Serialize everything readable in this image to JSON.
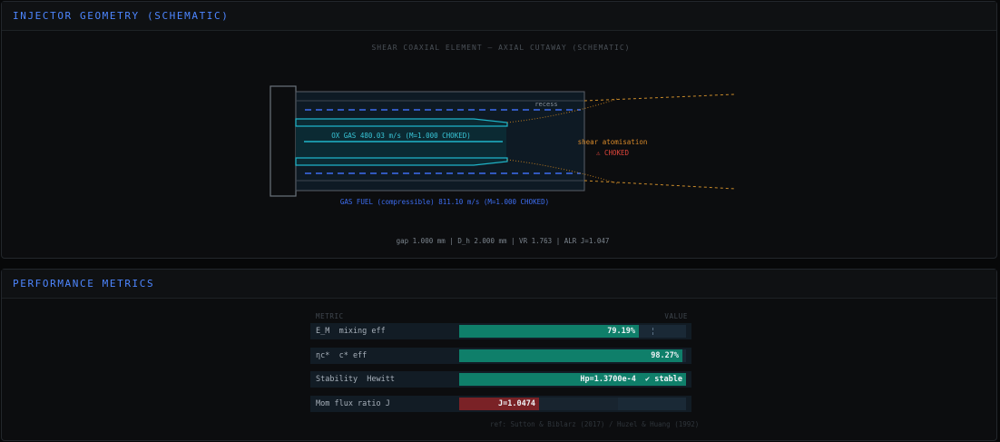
{
  "geometry_panel": {
    "title": "INJECTOR GEOMETRY (SCHEMATIC)",
    "diagram_title": "SHEAR COAXIAL ELEMENT — AXIAL CUTAWAY (SCHEMATIC)",
    "recess_label": "recess",
    "ox_label": "OX GAS 480.03 m/s (M=1.000 CHOKED)",
    "fuel_label": "GAS FUEL (compressible) 811.10 m/s (M=1.000 CHOKED)",
    "shear_label": "shear atomisation",
    "choked_label": "⚠ CHOKED",
    "footer": "gap 1.000 mm | D_h 2.000 mm | VR 1.763 | ALR J=1.047",
    "colors": {
      "oxidizer": "#1fb5c9",
      "fuel": "#3d6df0",
      "spray": "#c98a2a",
      "warning": "#e0453a",
      "body": "#6b737c"
    }
  },
  "performance_panel": {
    "title": "PERFORMANCE METRICS",
    "col_metric": "METRIC",
    "col_value": "VALUE",
    "rows": [
      {
        "label": "E_M  mixing eff",
        "value": "79.19%",
        "fill_fraction": 0.792,
        "marker_fraction": 0.85,
        "color": "#0f7f6a"
      },
      {
        "label": "ηc*  c* eff",
        "value": "98.27%",
        "fill_fraction": 0.983,
        "color": "#0f7f6a"
      },
      {
        "label": "Stability  Hewitt",
        "value": "Hp=1.3700e-4  ✔ stable",
        "fill_fraction": 1.0,
        "color": "#0f7f6a"
      },
      {
        "label": "Mom flux ratio J",
        "value": "J=1.0474",
        "fill_fraction": 0.35,
        "secondary_fraction": 0.7,
        "color": "#7a2226"
      }
    ],
    "reference": "ref: Sutton & Biblarz (2017) / Huzel & Huang (1992)"
  }
}
